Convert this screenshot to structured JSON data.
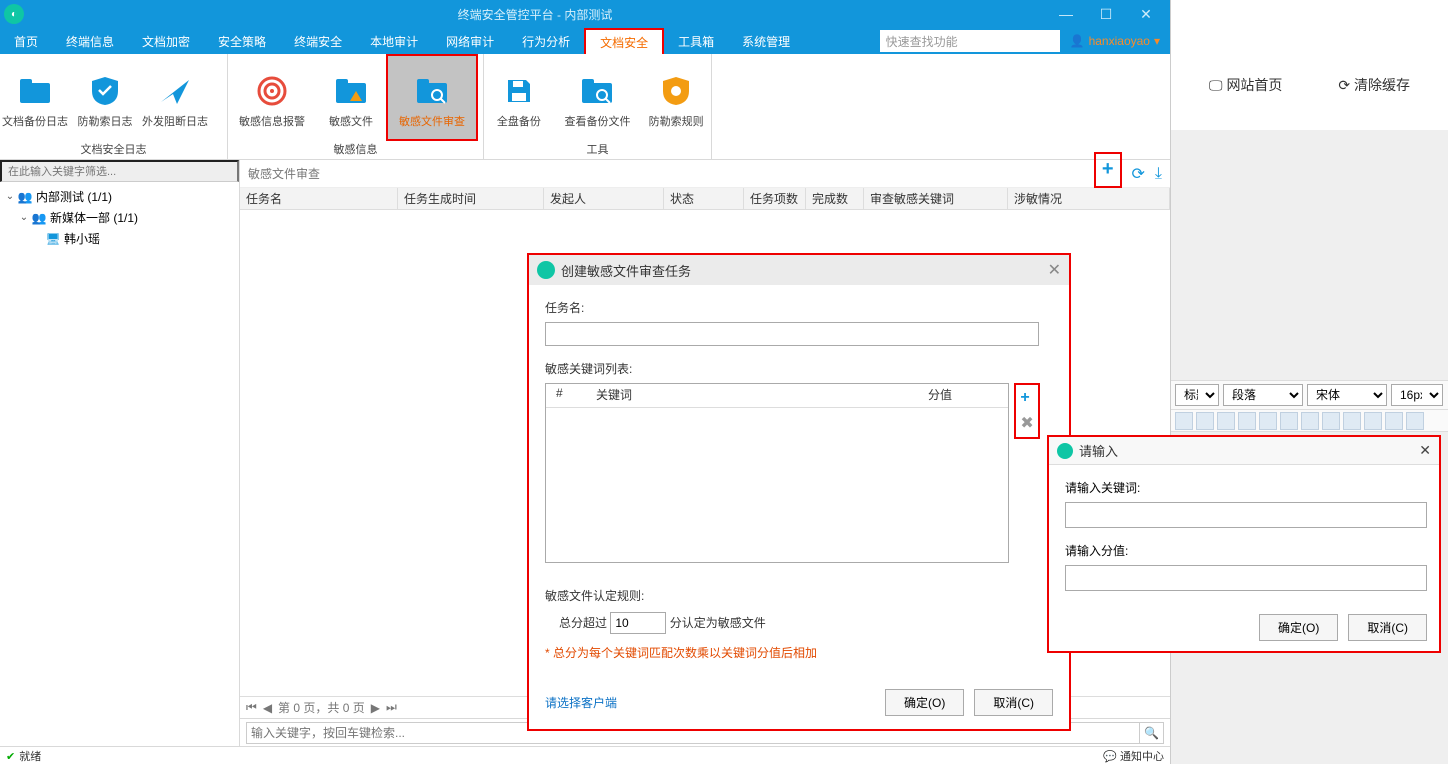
{
  "titlebar": {
    "title": "终端安全管控平台 - 内部测试"
  },
  "menubar": {
    "items": [
      "首页",
      "终端信息",
      "文档加密",
      "安全策略",
      "终端安全",
      "本地审计",
      "网络审计",
      "行为分析",
      "文档安全",
      "工具箱",
      "系统管理"
    ],
    "search_placeholder": "快速查找功能",
    "user": "hanxiaoyao"
  },
  "ribbon": {
    "group1": {
      "label": "文档安全日志",
      "items": [
        "文档备份日志",
        "防勒索日志",
        "外发阻断日志"
      ]
    },
    "group2": {
      "label": "敏感信息",
      "items": [
        "敏感信息报警",
        "敏感文件",
        "敏感文件审查"
      ]
    },
    "group3": {
      "label": "工具",
      "items": [
        "全盘备份",
        "查看备份文件",
        "防勒索规则"
      ]
    }
  },
  "tree": {
    "filter_placeholder": "在此输入关键字筛选...",
    "n1": "内部测试 (1/1)",
    "n2": "新媒体一部 (1/1)",
    "n3": "韩小瑶"
  },
  "crumb": {
    "text": "敏感文件审查"
  },
  "grid": {
    "cols": [
      "任务名",
      "任务生成时间",
      "发起人",
      "状态",
      "任务项数",
      "完成数",
      "审查敏感关键词",
      "涉敏情况"
    ]
  },
  "pager": {
    "text": "第 0 页，共 0 页"
  },
  "searchrow": {
    "placeholder": "输入关键字，按回车键检索..."
  },
  "status": {
    "ready": "就绪",
    "notice": "通知中心"
  },
  "dlg1": {
    "title": "创建敏感文件审查任务",
    "taskname_label": "任务名:",
    "kwlist_label": "敏感关键词列表:",
    "kw_col_hash": "#",
    "kw_col_kw": "关键词",
    "kw_col_score": "分值",
    "rule_label": "敏感文件认定规则:",
    "rule_total": "总分超过",
    "rule_value": "10",
    "rule_suffix": "分认定为敏感文件",
    "rule_note": "* 总分为每个关键词匹配次数乘以关键词分值后相加",
    "select_client": "请选择客户端",
    "ok": "确定(O)",
    "cancel": "取消(C)"
  },
  "dlg2": {
    "title": "请输入",
    "kw_label": "请输入关键词:",
    "score_label": "请输入分值:",
    "ok": "确定(O)",
    "cancel": "取消(C)"
  },
  "side": {
    "home": "网站首页",
    "clear": "清除缓存",
    "sel1": "标题",
    "sel2": "段落",
    "sel3": "宋体",
    "sel4": "16px"
  }
}
